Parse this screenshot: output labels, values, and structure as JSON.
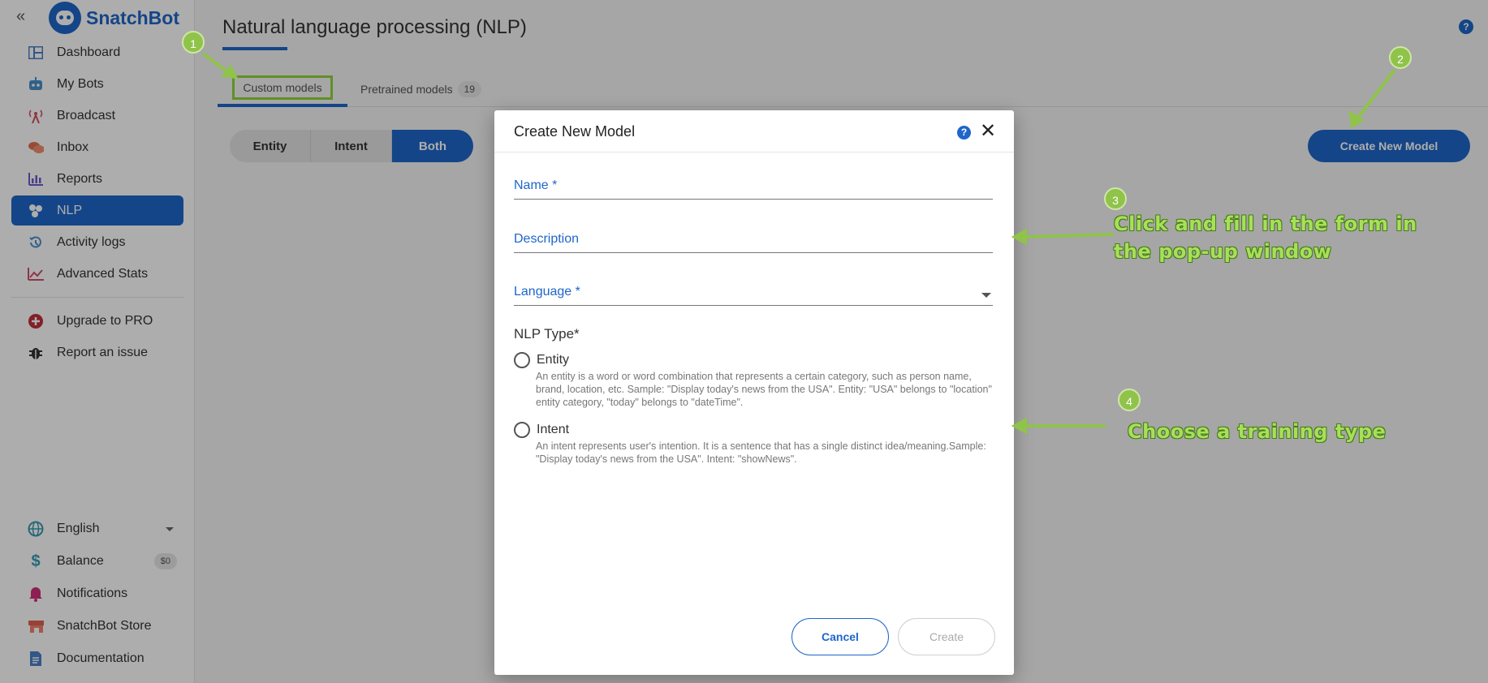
{
  "brand": {
    "name": "SnatchBot"
  },
  "sidebar": {
    "items": [
      {
        "label": "Dashboard",
        "icon": "dashboard-icon"
      },
      {
        "label": "My Bots",
        "icon": "robot-icon"
      },
      {
        "label": "Broadcast",
        "icon": "broadcast-icon"
      },
      {
        "label": "Inbox",
        "icon": "chat-icon"
      },
      {
        "label": "Reports",
        "icon": "reports-icon"
      },
      {
        "label": "NLP",
        "icon": "nlp-icon",
        "active": true
      },
      {
        "label": "Activity logs",
        "icon": "history-icon"
      },
      {
        "label": "Advanced Stats",
        "icon": "chart-icon"
      }
    ],
    "secondary": [
      {
        "label": "Upgrade to PRO",
        "icon": "upgrade-icon"
      },
      {
        "label": "Report an issue",
        "icon": "bug-icon"
      }
    ],
    "bottom": {
      "language": "English",
      "balance_label": "Balance",
      "balance_value": "$0",
      "notifications": "Notifications",
      "store": "SnatchBot Store",
      "documentation": "Documentation"
    }
  },
  "header": {
    "title": "Natural language processing (NLP)"
  },
  "tabs": {
    "custom": "Custom models",
    "pretrained": "Pretrained models",
    "pretrained_count": "19"
  },
  "filter": {
    "entity": "Entity",
    "intent": "Intent",
    "both": "Both",
    "selected": "Both"
  },
  "create_button": "Create New Model",
  "modal": {
    "title": "Create New Model",
    "name_label": "Name *",
    "description_label": "Description",
    "language_label": "Language *",
    "nlp_type_label": "NLP Type*",
    "entity_label": "Entity",
    "entity_desc": "An entity is a word or word combination that represents a certain category, such as person name, brand, location, etc. Sample: \"Display today's news from the USA\". Entity: \"USA\" belongs to \"location\" entity category, \"today\" belongs to \"dateTime\".",
    "intent_label": "Intent",
    "intent_desc": "An intent represents user's intention. It is a sentence that has a single distinct idea/meaning.Sample: \"Display today's news from the USA\". Intent: \"showNews\".",
    "cancel": "Cancel",
    "create": "Create"
  },
  "annotations": {
    "step1": "1",
    "step2": "2",
    "step3": "3",
    "step4": "4",
    "text3_line1": "Click and fill in the form in",
    "text3_line2": "the pop-up window",
    "text4": "Choose a training type"
  },
  "colors": {
    "accent": "#1e66c9",
    "annotation": "#8fc34a"
  }
}
